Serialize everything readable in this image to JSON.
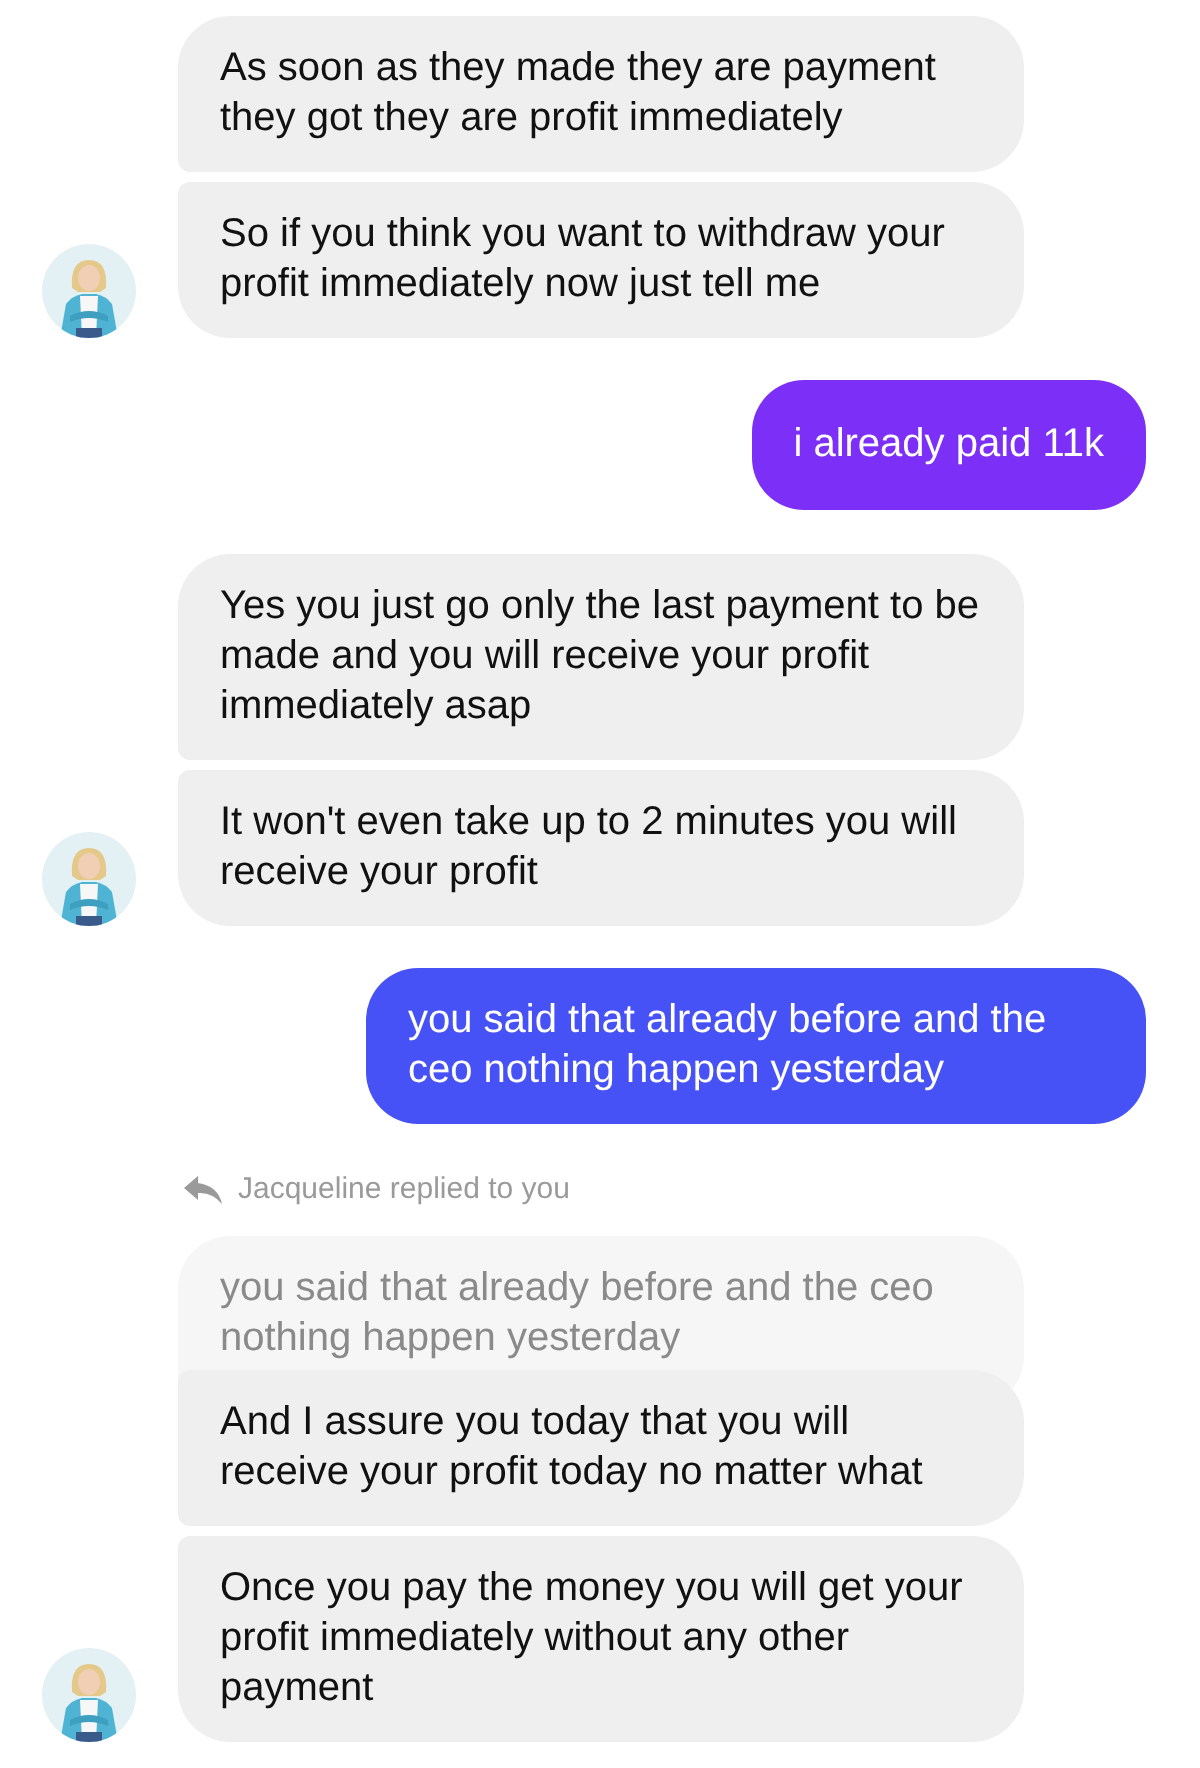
{
  "messages": [
    {
      "kind": "received",
      "bubbles": [
        "As soon as they made they are payment they got they are profit immediately",
        "So if you think you want to withdraw your profit immediately now just tell me"
      ]
    },
    {
      "kind": "sent",
      "text": "i already paid 11k",
      "color": "#7b2ff7"
    },
    {
      "kind": "received",
      "bubbles": [
        "Yes you just go only the last payment to be made and you will receive your profit immediately asap",
        "It won't even take up to 2 minutes you will receive your profit"
      ]
    },
    {
      "kind": "sent",
      "text": "you said that already before and the ceo nothing happen yesterday",
      "color": "#4652f6"
    },
    {
      "kind": "received",
      "reply": {
        "label": "Jacqueline replied to you",
        "quote": "you said that already before and the ceo nothing happen yesterday"
      },
      "bubbles": [
        "And I assure you today that you will receive your profit today no matter what",
        "Once you pay the money you will get your profit immediately without any other payment"
      ]
    }
  ]
}
